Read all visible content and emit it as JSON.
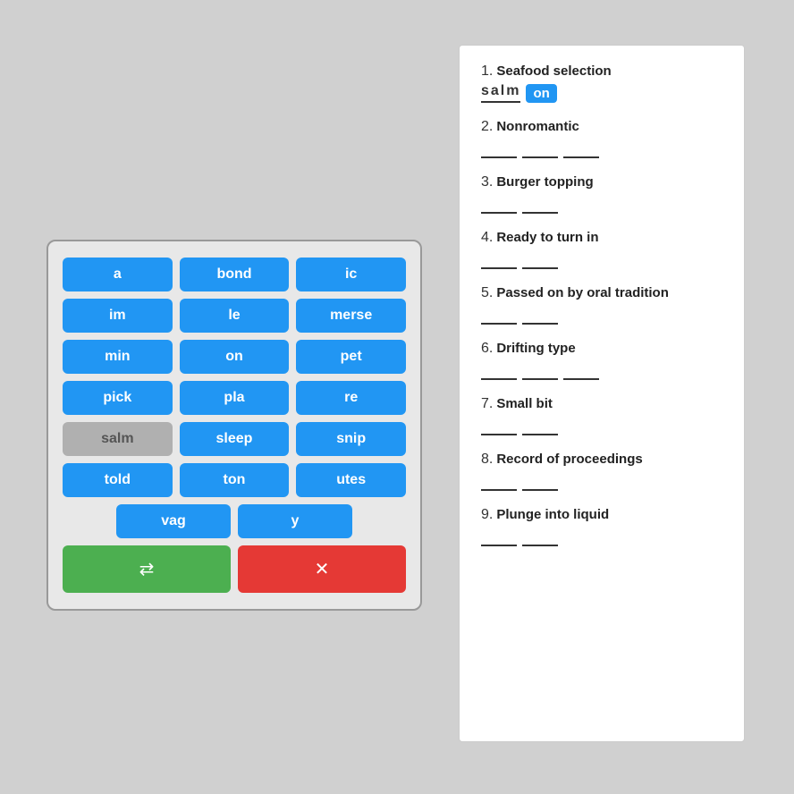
{
  "keyboard": {
    "keys": [
      {
        "label": "a",
        "grey": false
      },
      {
        "label": "bond",
        "grey": false
      },
      {
        "label": "ic",
        "grey": false
      },
      {
        "label": "im",
        "grey": false
      },
      {
        "label": "le",
        "grey": false
      },
      {
        "label": "merse",
        "grey": false
      },
      {
        "label": "min",
        "grey": false
      },
      {
        "label": "on",
        "grey": false
      },
      {
        "label": "pet",
        "grey": false
      },
      {
        "label": "pick",
        "grey": false
      },
      {
        "label": "pla",
        "grey": false
      },
      {
        "label": "re",
        "grey": false
      },
      {
        "label": "salm",
        "grey": true
      },
      {
        "label": "sleep",
        "grey": false
      },
      {
        "label": "snip",
        "grey": false
      },
      {
        "label": "told",
        "grey": false
      },
      {
        "label": "ton",
        "grey": false
      },
      {
        "label": "utes",
        "grey": false
      }
    ],
    "bottom_keys": [
      {
        "label": "vag",
        "grey": false
      },
      {
        "label": "y",
        "grey": false
      }
    ],
    "shuffle_label": "⇄",
    "delete_label": "✕"
  },
  "clues": [
    {
      "number": "1.",
      "text": "Seafood selection",
      "answer_parts": [
        {
          "text": "salm",
          "filled": true
        },
        {
          "text": "on",
          "highlight": true
        }
      ]
    },
    {
      "number": "2.",
      "text": "Nonromantic",
      "answer_parts": [
        {
          "text": "_____ "
        },
        {
          "text": "_____"
        },
        {
          "text": "_____"
        }
      ]
    },
    {
      "number": "3.",
      "text": "Burger topping",
      "answer_parts": [
        {
          "text": "_____"
        },
        {
          "text": "_____"
        }
      ]
    },
    {
      "number": "4.",
      "text": "Ready to turn in",
      "answer_parts": [
        {
          "text": "_____"
        },
        {
          "text": "_____"
        }
      ]
    },
    {
      "number": "5.",
      "text": "Passed on by oral tradition",
      "answer_parts": [
        {
          "text": "_____"
        },
        {
          "text": "_____"
        }
      ]
    },
    {
      "number": "6.",
      "text": "Drifting type",
      "answer_parts": [
        {
          "text": "_____"
        },
        {
          "text": "_____"
        },
        {
          "text": "_____"
        }
      ]
    },
    {
      "number": "7.",
      "text": "Small bit",
      "answer_parts": [
        {
          "text": "_____"
        },
        {
          "text": "_____"
        }
      ]
    },
    {
      "number": "8.",
      "text": "Record of proceedings",
      "answer_parts": [
        {
          "text": "_____"
        },
        {
          "text": "_____"
        }
      ]
    },
    {
      "number": "9.",
      "text": "Plunge into liquid",
      "answer_parts": [
        {
          "text": "_____"
        },
        {
          "text": "_____"
        }
      ]
    }
  ]
}
